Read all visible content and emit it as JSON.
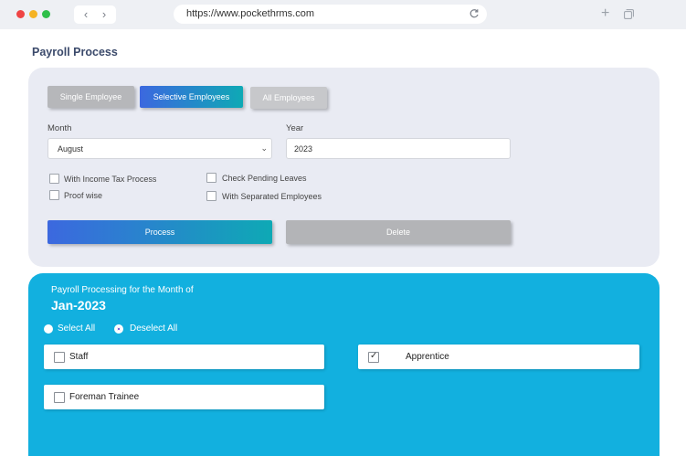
{
  "browser": {
    "url": "https://www.pockethrms.com"
  },
  "page": {
    "title": "Payroll Process"
  },
  "modes": {
    "single": "Single Employee",
    "selective": "Selective Employees",
    "all": "All Employees",
    "active": "selective"
  },
  "form": {
    "month_label": "Month",
    "month_value": "August",
    "year_label": "Year",
    "year_value": "2023",
    "options": {
      "income_tax": "With Income Tax Process",
      "proof_wise": "Proof wise",
      "pending_leaves": "Check Pending Leaves",
      "separated": "With Separated Employees"
    },
    "process_label": "Process",
    "delete_label": "Delete"
  },
  "panel": {
    "subtitle": "Payroll Processing for the Month of",
    "month": "Jan-2023",
    "select_all": "Select All",
    "deselect_all": "Deselect All",
    "selected_radio": "deselect_all",
    "categories": [
      {
        "label": "Staff",
        "checked": false
      },
      {
        "label": "Apprentice",
        "checked": true
      },
      {
        "label": "Foreman Trainee",
        "checked": false
      }
    ]
  },
  "colors": {
    "accent_blue": "#3c68df",
    "accent_teal": "#0ea9b5",
    "panel_blue": "#12b0df",
    "title": "#3b4a6b"
  }
}
